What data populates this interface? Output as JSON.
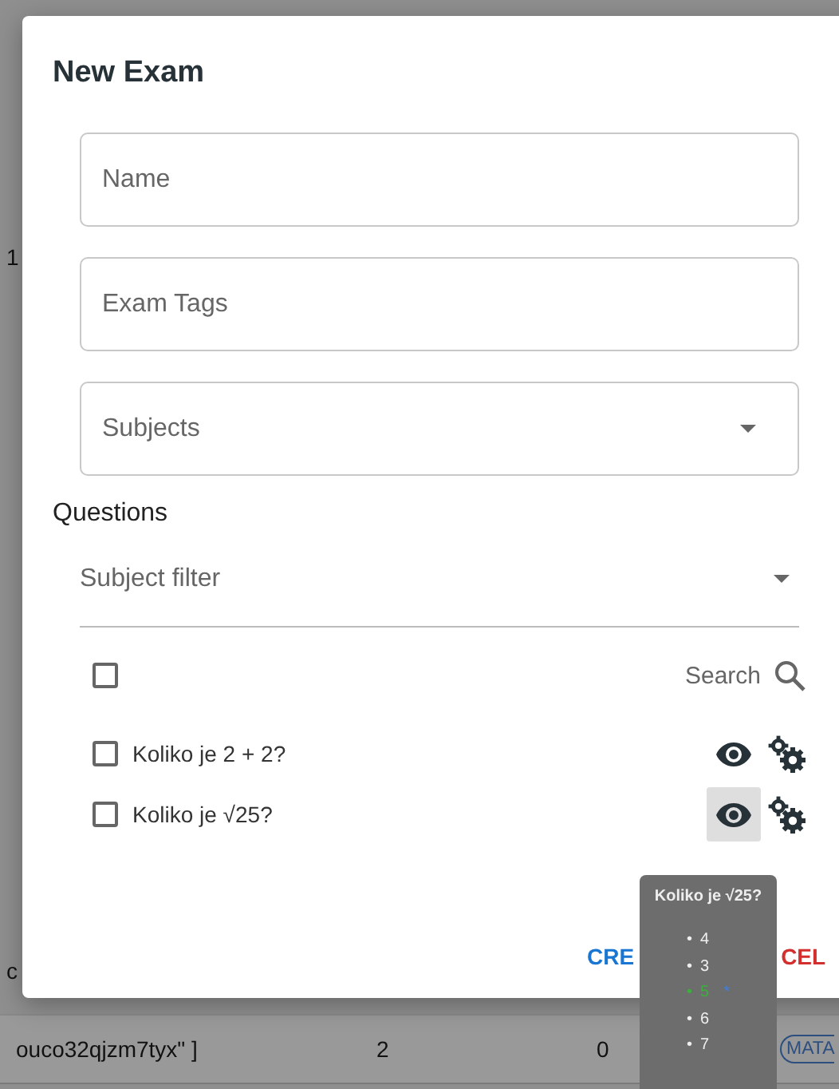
{
  "background": {
    "fragments": [
      "1",
      "c"
    ],
    "row": {
      "cells": [
        "ouco32qjzm7tyx\" ]",
        "2",
        "0"
      ],
      "chip": "MATA"
    }
  },
  "dialog": {
    "title": "New Exam",
    "fields": [
      {
        "kind": "text",
        "placeholder": "Name"
      },
      {
        "kind": "text",
        "placeholder": "Exam Tags"
      },
      {
        "kind": "select",
        "placeholder": "Subjects"
      }
    ],
    "questions_label": "Questions",
    "subject_filter": {
      "placeholder": "Subject filter"
    },
    "select_all": {
      "checked": false
    },
    "search": {
      "placeholder": "Search"
    },
    "questions": [
      {
        "text": "Koliko je 2 + 2?",
        "checked": false,
        "hovered": false
      },
      {
        "text": "Koliko je √25?",
        "checked": false,
        "hovered": true
      }
    ],
    "buttons": [
      {
        "label": "CRE",
        "kind": "primary"
      },
      {
        "label": "CEL",
        "kind": "danger"
      }
    ]
  },
  "tooltip": {
    "title": "Koliko je √25?",
    "answers": [
      {
        "bullet": "•",
        "text": "4",
        "correct": false
      },
      {
        "bullet": "•",
        "text": "3",
        "correct": false
      },
      {
        "bullet": "•",
        "text": "5",
        "correct": true,
        "mark": "*"
      },
      {
        "bullet": "•",
        "text": "6",
        "correct": false
      },
      {
        "bullet": "•",
        "text": "7",
        "correct": false
      }
    ]
  }
}
